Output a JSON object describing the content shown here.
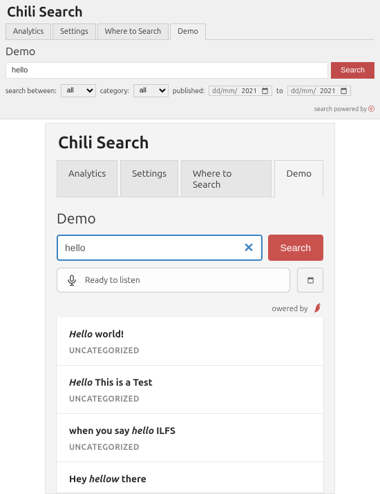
{
  "top": {
    "title": "Chili Search",
    "tabs": [
      "Analytics",
      "Settings",
      "Where to Search",
      "Demo"
    ],
    "active_tab": 3,
    "section_label": "Demo",
    "search_value": "hello",
    "search_button": "Search",
    "filters": {
      "search_between_label": "search between:",
      "search_between_value": "all",
      "category_label": "category:",
      "category_value": "all",
      "published_label": "published:",
      "date_placeholder_prefix": "dd/mm/",
      "date_year": "2021",
      "to_label": "to"
    },
    "powered_by": "search powered by"
  },
  "main": {
    "title": "Chili Search",
    "tabs": [
      "Analytics",
      "Settings",
      "Where to Search",
      "Demo"
    ],
    "active_tab": 3,
    "section_label": "Demo",
    "search_value": "hello",
    "search_button": "Search",
    "listen_label": "Ready to listen",
    "powered_by": "owered by",
    "suggestions": [
      {
        "pre": "",
        "hl": "Hello",
        "post": " world!",
        "category": "UNCATEGORIZED"
      },
      {
        "pre": "",
        "hl": "Hello",
        "post": " This is a Test",
        "category": "UNCATEGORIZED"
      },
      {
        "pre": "when you say ",
        "hl": "hello",
        "post": " ILFS",
        "category": "UNCATEGORIZED"
      },
      {
        "pre": "Hey ",
        "hl": "hellow",
        "post": " there",
        "category": ""
      }
    ]
  }
}
